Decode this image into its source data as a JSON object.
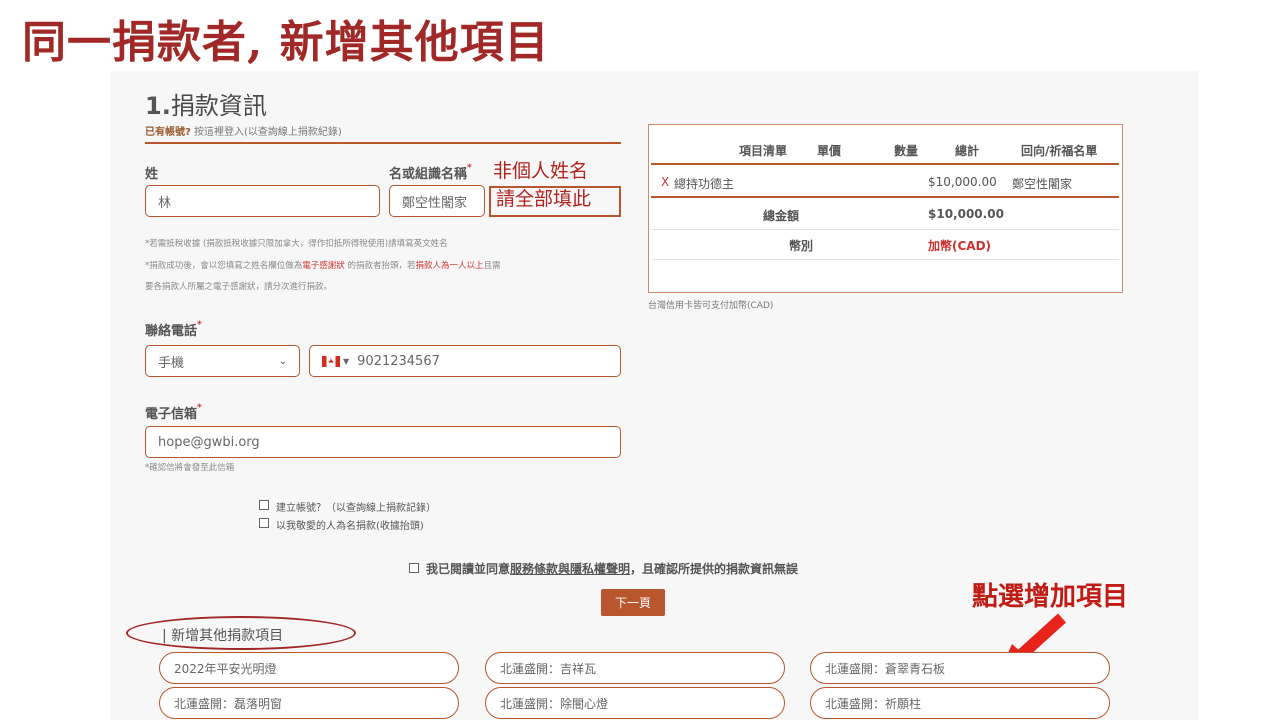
{
  "slide": {
    "title": "同一捐款者, 新增其他項目"
  },
  "form": {
    "section_title_num": "1.",
    "section_title": "捐款資訊",
    "login_hint_bold": "已有帳號?",
    "login_hint": "按這裡登入(以查詢線上捐款紀錄)",
    "surname_label": "姓",
    "surname_value": "林",
    "name_label": "名或組識名稱",
    "name_value": "鄭空性闍家",
    "required_mark": "*",
    "annotation_line1": "非個人姓名",
    "annotation_line2": "請全部填此",
    "note1": "*若需抵稅收據 (捐款抵稅收據只限加拿大，得作扣抵所得稅使用)請填寫英文姓名",
    "note2_a": "*捐款成功後，會以您填寫之姓名欄位做為",
    "note2_b": "電子感謝狀",
    "note2_c": " 的捐款者抬頭，若",
    "note2_d": "捐款人為一人以上",
    "note2_e": "且需",
    "note3": "要各捐款人所屬之電子感謝狀，請分次進行捐款。",
    "phone_label": "聯絡電話",
    "phone_type": "手機",
    "phone_number": "9021234567",
    "email_label": "電子信箱",
    "email_value": "hope@gwbi.org",
    "email_note": "*確認信將會發至此信箱",
    "cb_create_account": "建立帳號？（以查詢線上捐款記錄）",
    "cb_honor": "以我敬愛的人為名捐款(收據抬頭)",
    "agree_a": "我已閱讀並同意",
    "agree_link": "服務條款與隱私權聲明",
    "agree_b": "，且確認所提供的捐款資訊無誤",
    "next_button": "下一頁"
  },
  "summary_table": {
    "headers": [
      "項目清單",
      "單價",
      "數量",
      "總計",
      "回向/祈福名單"
    ],
    "row": {
      "remove": "X",
      "item": "總持功德主",
      "total": "$10,000.00",
      "dedication": "鄭空性闍家"
    },
    "total_label": "總金額",
    "total_value": "$10,000.00",
    "currency_label": "幣別",
    "currency_value": "加幣(CAD)",
    "card_note": "台灣信用卡皆可支付加幣(CAD)"
  },
  "add_items": {
    "heading": "| 新增其他捐款項目",
    "callout": "點選增加項目",
    "items": [
      "2022年平安光明燈",
      "北蓮盛開：吉祥瓦",
      "北蓮盛開：蒼翠青石板",
      "北蓮盛開：磊落明窗",
      "北蓮盛開：除闇心燈",
      "北蓮盛開：祈願柱"
    ]
  },
  "colors": {
    "accent": "#b8562e",
    "title_red": "#a02826",
    "arrow_red": "#e8231c"
  }
}
